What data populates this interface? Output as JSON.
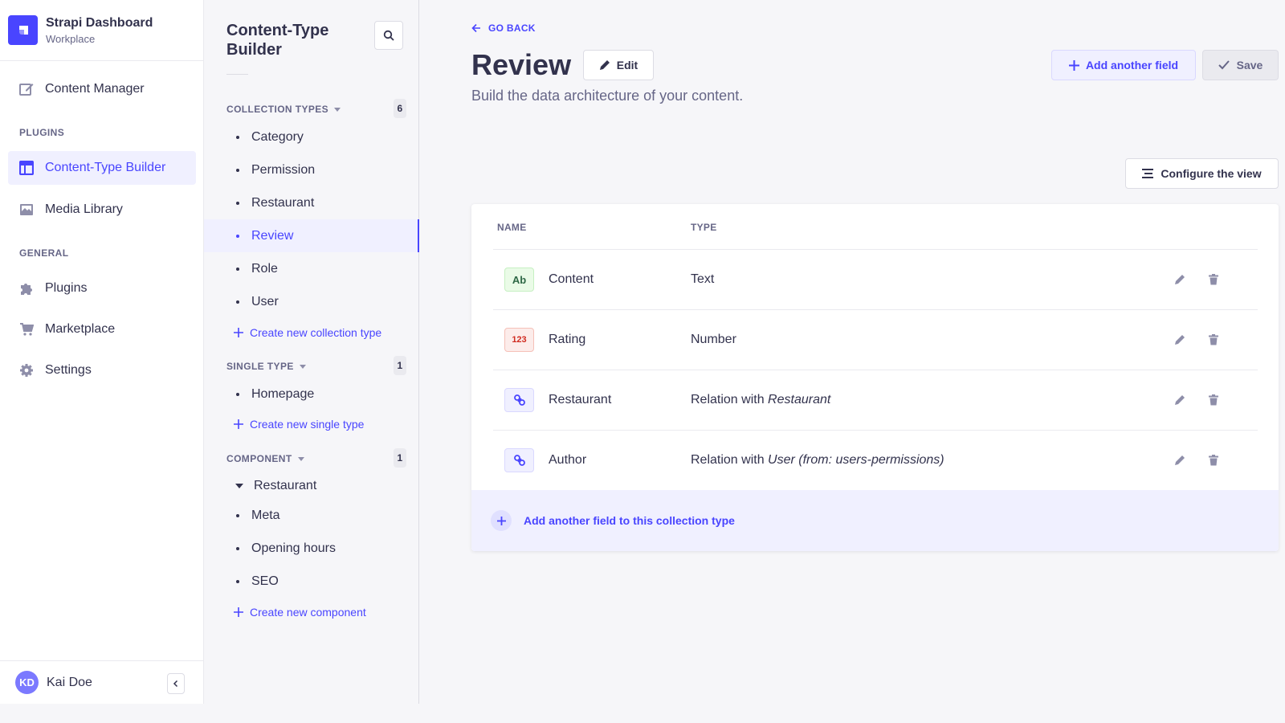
{
  "brand": {
    "title": "Strapi Dashboard",
    "subtitle": "Workplace"
  },
  "main_nav": {
    "content_manager": "Content Manager",
    "plugins_section": "PLUGINS",
    "content_type_builder": "Content-Type Builder",
    "media_library": "Media Library",
    "general_section": "GENERAL",
    "plugins": "Plugins",
    "marketplace": "Marketplace",
    "settings": "Settings"
  },
  "user": {
    "initials": "KD",
    "name": "Kai Doe"
  },
  "sub_nav": {
    "title": "Content-Type Builder",
    "collection_types": {
      "label": "COLLECTION TYPES",
      "count": "6",
      "items": [
        "Category",
        "Permission",
        "Restaurant",
        "Review",
        "Role",
        "User"
      ],
      "active": "Review",
      "create_label": "Create new collection type"
    },
    "single_type": {
      "label": "SINGLE TYPE",
      "count": "1",
      "items": [
        "Homepage"
      ],
      "create_label": "Create new single type"
    },
    "component": {
      "label": "COMPONENT",
      "count": "1",
      "group": "Restaurant",
      "items": [
        "Meta",
        "Opening hours",
        "SEO"
      ],
      "create_label": "Create new component"
    }
  },
  "header": {
    "go_back": "GO BACK",
    "title": "Review",
    "edit_label": "Edit",
    "subtitle": "Build the data architecture of your content.",
    "add_field_label": "Add another field",
    "save_label": "Save",
    "configure_label": "Configure the view"
  },
  "table": {
    "headers": {
      "name": "NAME",
      "type": "TYPE"
    },
    "rows": [
      {
        "badge": "Ab",
        "name": "Content",
        "type_prefix": "Text",
        "type_target": ""
      },
      {
        "badge": "123",
        "name": "Rating",
        "type_prefix": "Number",
        "type_target": ""
      },
      {
        "badge": "link-icon",
        "name": "Restaurant",
        "type_prefix": "Relation with ",
        "type_target": "Restaurant"
      },
      {
        "badge": "link-icon",
        "name": "Author",
        "type_prefix": "Relation with ",
        "type_target": "User (from: users-permissions)"
      }
    ],
    "footer_label": "Add another field to this collection type"
  },
  "colors": {
    "primary": "#4945ff",
    "primary_light": "#f0f0ff",
    "text": "#32324d",
    "muted": "#666687",
    "success_bg": "#eafbe7",
    "danger_bg": "#fcecea"
  }
}
